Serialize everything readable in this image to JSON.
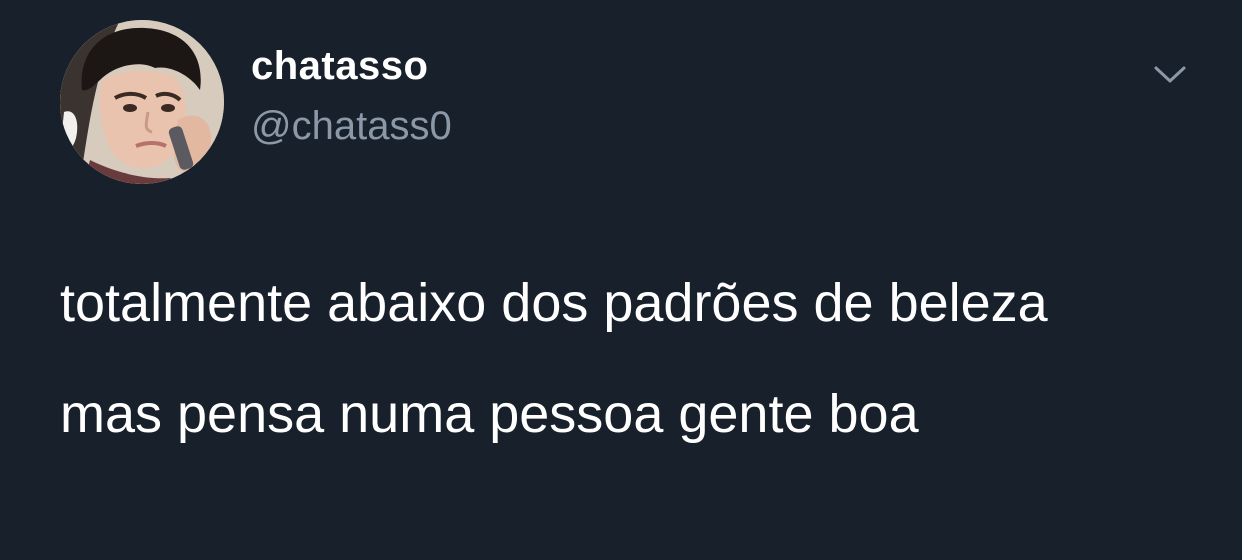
{
  "author": {
    "display_name": "chatasso",
    "handle": "@chatass0",
    "avatar_icon": "profile-photo"
  },
  "menu": {
    "icon": "chevron-down-icon"
  },
  "tweet": {
    "paragraphs": [
      "totalmente abaixo dos padrões de beleza",
      "mas pensa numa pessoa gente boa"
    ]
  },
  "colors": {
    "background": "#18202b",
    "text_primary": "#ffffff",
    "text_secondary": "#8a98a8"
  }
}
